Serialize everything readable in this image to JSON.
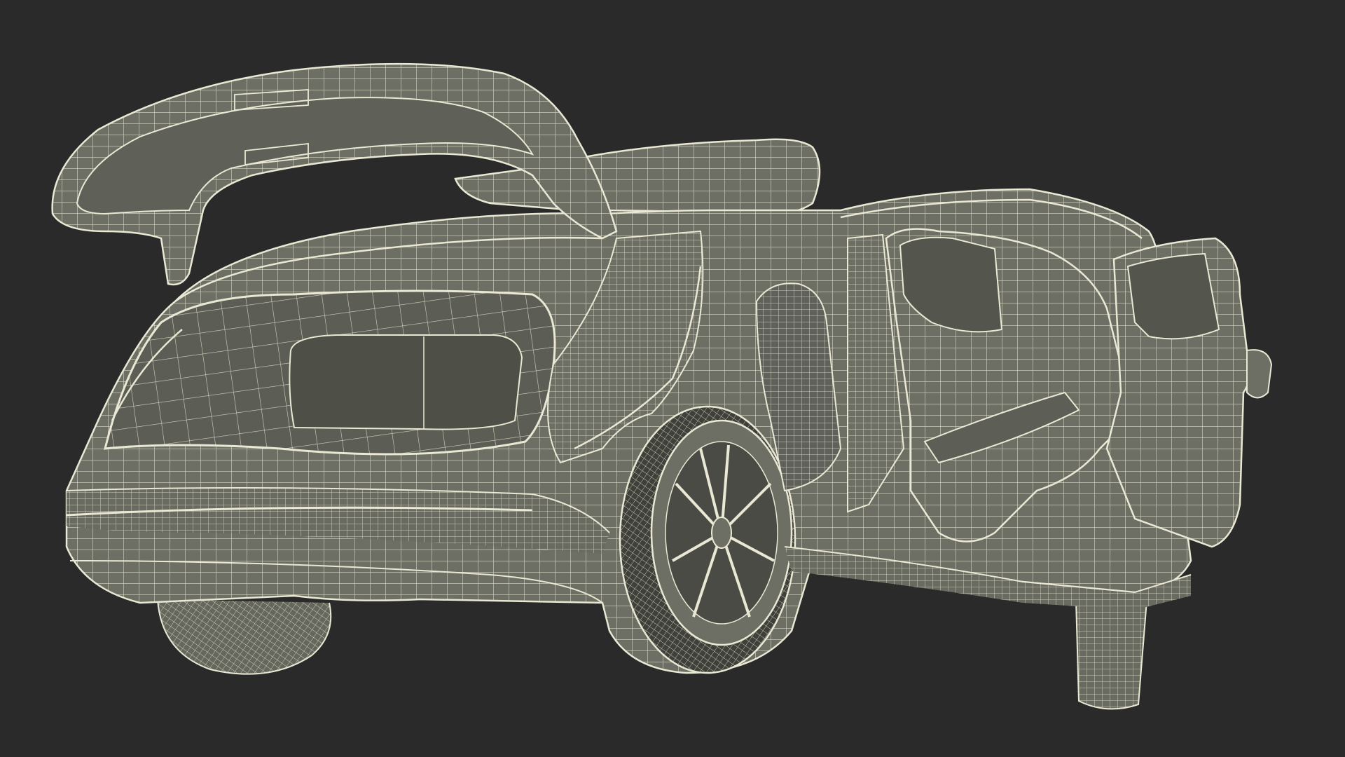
{
  "scene": {
    "background_color": "#2a2a2a",
    "model_fill_color": "#6e6f64",
    "model_shade_color": "#55564d",
    "wire_color": "#e9e8d4",
    "subject": "car-wireframe-render"
  }
}
